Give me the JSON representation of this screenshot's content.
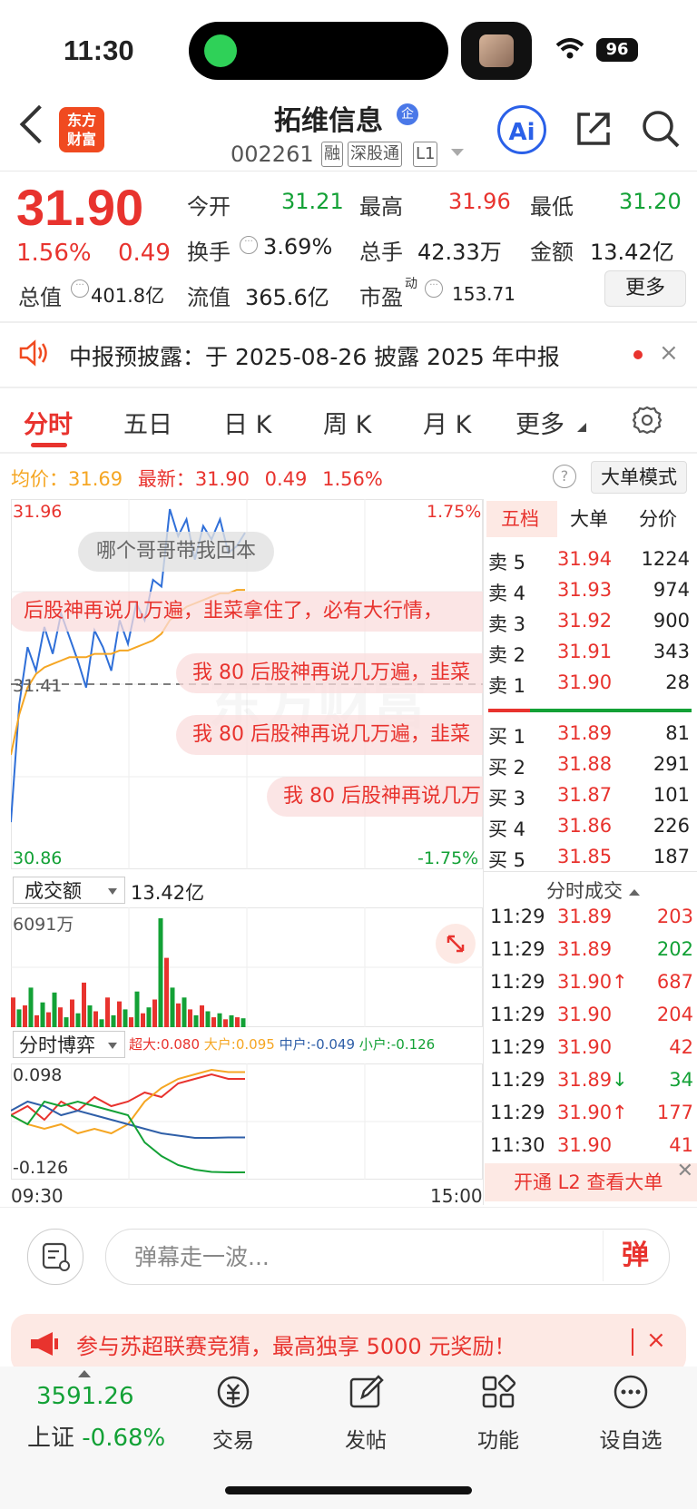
{
  "status_bar": {
    "time": "11:30",
    "battery": "96"
  },
  "header": {
    "logo_text": "东方财富",
    "stock_name": "拓维信息",
    "name_badge": "企",
    "stock_code": "002261",
    "tags": [
      "融",
      "深股通",
      "L1"
    ],
    "ai_label": "Ai"
  },
  "quote": {
    "price": "31.90",
    "change_pct": "1.56%",
    "change": "0.49",
    "rows": [
      [
        {
          "label": "今开",
          "value": "31.21",
          "color": "green"
        },
        {
          "label": "最高",
          "value": "31.96",
          "color": "red"
        },
        {
          "label": "最低",
          "value": "31.20",
          "color": "green"
        }
      ],
      [
        {
          "label": "换手",
          "value": "3.69%",
          "color": "dark"
        },
        {
          "label": "总手",
          "value": "42.33万",
          "color": "dark"
        },
        {
          "label": "金额",
          "value": "13.42亿",
          "color": "dark"
        }
      ],
      [
        {
          "label": "总值",
          "value": "401.8亿",
          "color": "dark"
        },
        {
          "label": "流值",
          "value": "365.6亿",
          "color": "dark"
        },
        {
          "label": "市盈",
          "value": "153.71",
          "color": "dark"
        }
      ]
    ],
    "pe_superscript": "动",
    "more_label": "更多"
  },
  "notice": {
    "text": "中报预披露：于 2025-08-26 披露 2025 年中报",
    "close": "×"
  },
  "tabs": [
    "分时",
    "五日",
    "日 K",
    "周 K",
    "月 K",
    "更多"
  ],
  "chart_header": {
    "avg_label": "均价：",
    "avg_value": "31.69",
    "latest_label": "最新：",
    "latest_value": "31.90",
    "change": "0.49",
    "change_pct": "1.56%",
    "help": "?",
    "big_order_mode": "大单模式"
  },
  "chart_data": {
    "type": "line",
    "y_max_label": "31.96",
    "y_mid_label": "31.41",
    "y_min_label": "30.86",
    "pct_max_label": "1.75%",
    "pct_min_label": "-1.75%",
    "ylim": [
      30.86,
      31.96
    ],
    "series": [
      {
        "name": "price",
        "color": "#2f6fd8",
        "values": [
          31.0,
          31.35,
          31.52,
          31.45,
          31.58,
          31.5,
          31.62,
          31.55,
          31.48,
          31.4,
          31.57,
          31.52,
          31.45,
          31.6,
          31.53,
          31.65,
          31.6,
          31.72,
          31.7,
          31.93,
          31.85,
          31.9,
          31.78,
          31.88,
          31.84,
          31.9,
          31.8,
          31.82,
          31.86
        ]
      },
      {
        "name": "avg",
        "color": "#f5a623",
        "values": [
          31.2,
          31.32,
          31.4,
          31.44,
          31.46,
          31.47,
          31.48,
          31.49,
          31.49,
          31.49,
          31.5,
          31.5,
          31.5,
          31.51,
          31.51,
          31.52,
          31.53,
          31.54,
          31.56,
          31.6,
          31.62,
          31.64,
          31.65,
          31.66,
          31.67,
          31.68,
          31.68,
          31.69,
          31.69
        ]
      }
    ],
    "volume": [
      30,
      18,
      22,
      40,
      12,
      25,
      15,
      35,
      20,
      10,
      28,
      14,
      45,
      22,
      16,
      8,
      30,
      12,
      26,
      18,
      10,
      36,
      14,
      20,
      28,
      110,
      70,
      40,
      24,
      30,
      18,
      12,
      22,
      16,
      10,
      14,
      8,
      12,
      10,
      9
    ],
    "game_series": [
      {
        "name": "超大",
        "color": "#e8332e",
        "values": [
          0.0,
          0.02,
          -0.01,
          0.03,
          0.01,
          0.04,
          0.02,
          0.03,
          0.05,
          0.04,
          0.07,
          0.08,
          0.09,
          0.08,
          0.08
        ]
      },
      {
        "name": "大户",
        "color": "#f5a623",
        "values": [
          0.0,
          -0.02,
          -0.03,
          -0.02,
          -0.04,
          -0.03,
          -0.04,
          -0.02,
          0.03,
          0.06,
          0.08,
          0.09,
          0.1,
          0.095,
          0.095
        ]
      },
      {
        "name": "中户",
        "color": "#2f5fa8",
        "values": [
          0.01,
          0.03,
          0.02,
          0.0,
          0.01,
          0.0,
          -0.01,
          -0.02,
          -0.03,
          -0.04,
          -0.045,
          -0.05,
          -0.05,
          -0.049,
          -0.049
        ]
      },
      {
        "name": "小户",
        "color": "#13a136",
        "values": [
          0.0,
          -0.02,
          0.03,
          0.02,
          0.03,
          0.02,
          0.01,
          0.0,
          -0.06,
          -0.09,
          -0.11,
          -0.12,
          -0.125,
          -0.126,
          -0.126
        ]
      }
    ],
    "game_ylim": [
      -0.126,
      0.098
    ]
  },
  "danmu": [
    "哪个哥哥带我回本",
    "后股神再说几万遍，韭菜拿住了，必有大行情，",
    "我 80 后股神再说几万遍，韭菜",
    "我 80 后股神再说几万遍，韭菜",
    "我 80 后股神再说几万"
  ],
  "order_book": {
    "tabs": [
      "五档",
      "大单",
      "分价"
    ],
    "asks": [
      {
        "label": "卖 5",
        "price": "31.94",
        "vol": "1224"
      },
      {
        "label": "卖 4",
        "price": "31.93",
        "vol": "974"
      },
      {
        "label": "卖 3",
        "price": "31.92",
        "vol": "900"
      },
      {
        "label": "卖 2",
        "price": "31.91",
        "vol": "343"
      },
      {
        "label": "卖 1",
        "price": "31.90",
        "vol": "28"
      }
    ],
    "bids": [
      {
        "label": "买 1",
        "price": "31.89",
        "vol": "81"
      },
      {
        "label": "买 2",
        "price": "31.88",
        "vol": "291"
      },
      {
        "label": "买 3",
        "price": "31.87",
        "vol": "101"
      },
      {
        "label": "买 4",
        "price": "31.86",
        "vol": "226"
      },
      {
        "label": "买 5",
        "price": "31.85",
        "vol": "187"
      }
    ]
  },
  "volume_panel": {
    "select_label": "成交额",
    "total": "13.42亿",
    "max_label": "6091万"
  },
  "game_panel": {
    "select_label": "分时博弈",
    "legend": [
      {
        "label": "超大:",
        "value": "0.080",
        "color": "#e8332e"
      },
      {
        "label": "大户:",
        "value": "0.095",
        "color": "#f5a623"
      },
      {
        "label": "中户:",
        "value": "-0.049",
        "color": "#2f5fa8"
      },
      {
        "label": "小户:",
        "value": "-0.126",
        "color": "#13a136"
      }
    ],
    "max_label": "0.098",
    "min_label": "-0.126"
  },
  "time_axis": {
    "start": "09:30",
    "end": "15:00"
  },
  "ticks": {
    "title": "分时成交",
    "rows": [
      {
        "time": "11:29",
        "price": "31.89",
        "vol": "203",
        "dir": "",
        "vol_color": "red"
      },
      {
        "time": "11:29",
        "price": "31.89",
        "vol": "202",
        "dir": "",
        "vol_color": "green"
      },
      {
        "time": "11:29",
        "price": "31.90",
        "vol": "687",
        "dir": "↑",
        "vol_color": "red"
      },
      {
        "time": "11:29",
        "price": "31.90",
        "vol": "204",
        "dir": "",
        "vol_color": "red"
      },
      {
        "time": "11:29",
        "price": "31.90",
        "vol": "42",
        "dir": "",
        "vol_color": "red"
      },
      {
        "time": "11:29",
        "price": "31.89",
        "vol": "34",
        "dir": "↓",
        "vol_color": "green"
      },
      {
        "time": "11:29",
        "price": "31.90",
        "vol": "177",
        "dir": "↑",
        "vol_color": "red"
      },
      {
        "time": "11:30",
        "price": "31.90",
        "vol": "41",
        "dir": "",
        "vol_color": "red"
      }
    ],
    "l2_banner": "开通 L2 查看大单"
  },
  "comment_bar": {
    "placeholder": "弹幕走一波...",
    "danmu_button": "弹"
  },
  "promo": {
    "text": "参与苏超联赛竞猜，最高独享 5000 元奖励！",
    "close": "×"
  },
  "bottom_nav": {
    "index_value": "3591.26",
    "index_name": "上证",
    "index_change": "-0.68%",
    "items": [
      "交易",
      "发帖",
      "功能",
      "设自选"
    ]
  }
}
